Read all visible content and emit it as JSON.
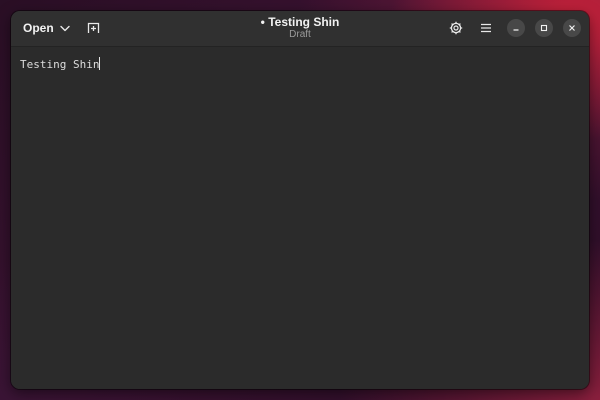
{
  "window": {
    "title": "Testing Shin",
    "modified_indicator": "•",
    "subtitle": "Draft"
  },
  "headerbar": {
    "open_label": "Open",
    "open_icon": "chevron-down-icon",
    "new_tab_icon": "new-tab-icon",
    "preferences_icon": "gear-icon",
    "menu_icon": "hamburger-menu-icon",
    "minimize_icon": "minimize-icon",
    "maximize_icon": "maximize-icon",
    "close_icon": "close-icon"
  },
  "editor": {
    "content": "Testing Shin"
  },
  "colors": {
    "window_bg": "#2b2b2b",
    "headerbar_bg": "#303030",
    "text": "#dcdcdc",
    "window_button_bg": "#484848"
  }
}
